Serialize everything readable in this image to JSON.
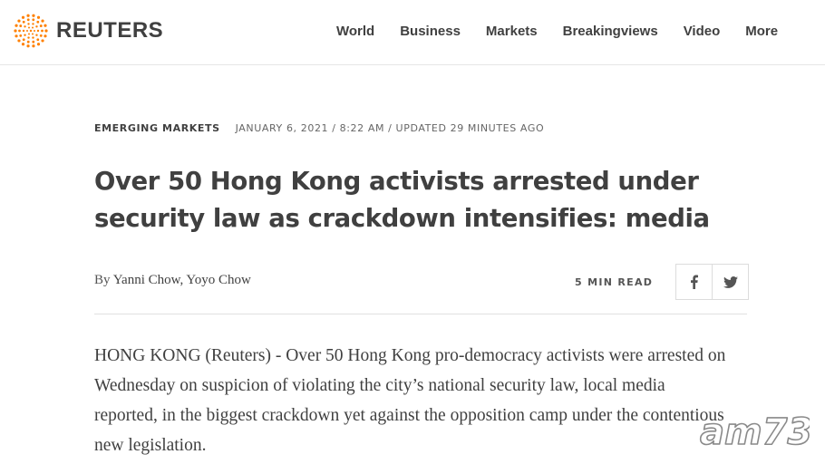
{
  "brand": {
    "name": "REUTERS",
    "color": "#ff8000"
  },
  "nav": {
    "items": [
      "World",
      "Business",
      "Markets",
      "Breakingviews",
      "Video",
      "More"
    ]
  },
  "article": {
    "section": "EMERGING MARKETS",
    "dateline": "JANUARY 6, 2021 / 8:22 AM / UPDATED 29 MINUTES AGO",
    "headline": "Over 50 Hong Kong activists arrested under security law as crackdown intensifies: media",
    "byline_prefix": "By",
    "authors": "Yanni Chow, Yoyo Chow",
    "read_time": "5 MIN READ",
    "body": "HONG KONG (Reuters) - Over 50 Hong Kong pro-democracy activists were arrested on Wednesday on suspicion of violating the city’s national security law, local media reported, in the biggest crackdown yet against the opposition camp under the contentious new legislation."
  },
  "share": {
    "icons": [
      "facebook-icon",
      "twitter-icon"
    ]
  },
  "watermark": {
    "text": "am730"
  }
}
